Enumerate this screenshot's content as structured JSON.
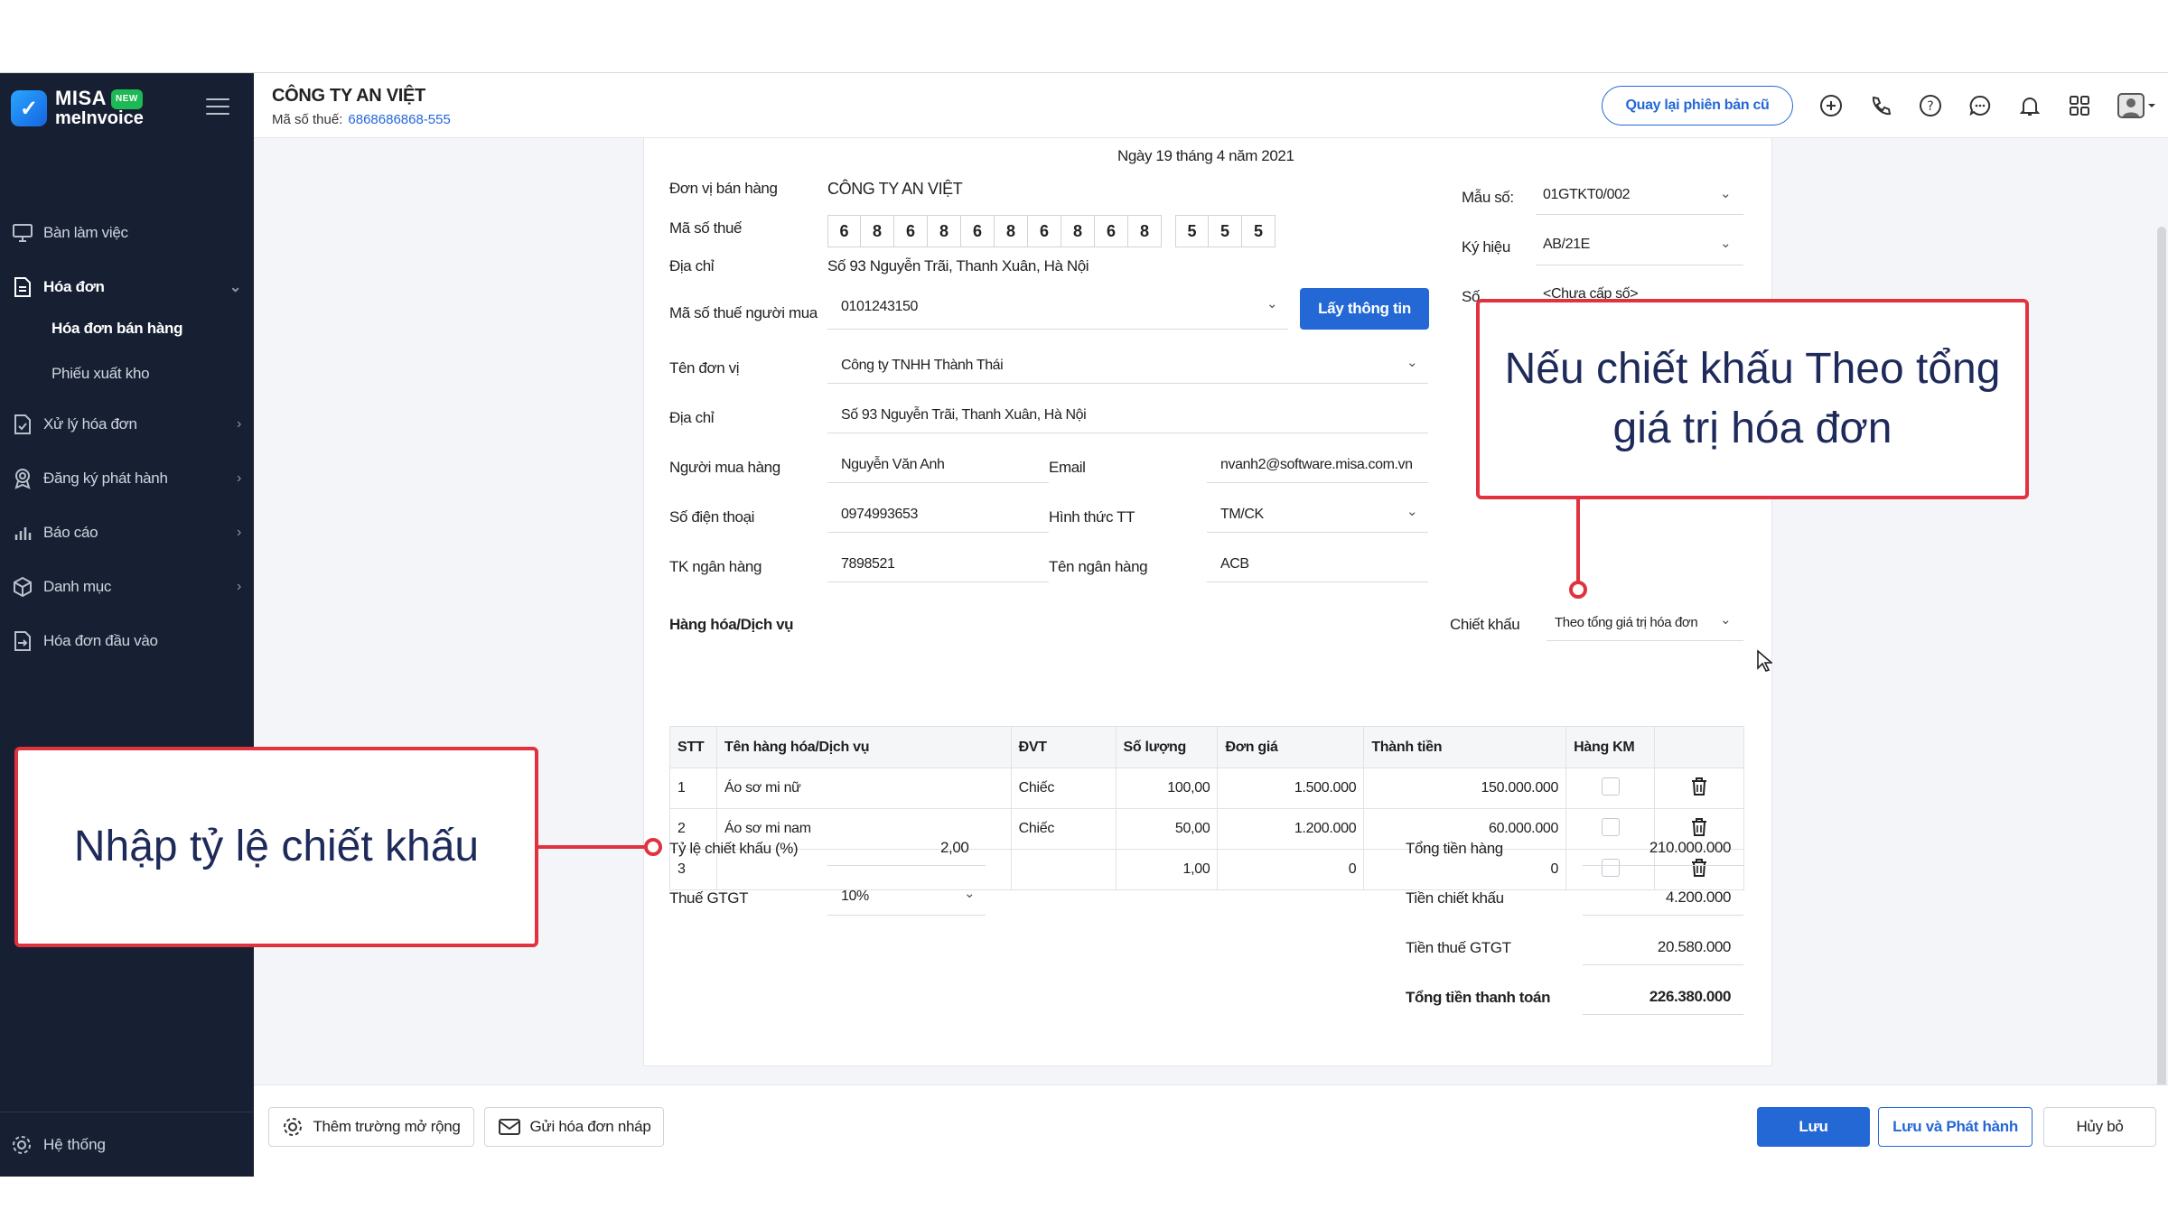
{
  "sidebar": {
    "logo_line1": "MISA",
    "logo_line2": "meInvoice",
    "logo_badge": "NEW",
    "items": [
      {
        "label": "Bàn làm việc"
      },
      {
        "label": "Hóa đơn"
      },
      {
        "label": "Xử lý hóa đơn"
      },
      {
        "label": "Đăng ký phát hành"
      },
      {
        "label": "Báo cáo"
      },
      {
        "label": "Danh mục"
      },
      {
        "label": "Hóa đơn đầu vào"
      }
    ],
    "subitems": [
      {
        "label": "Hóa đơn bán hàng"
      },
      {
        "label": "Phiếu xuất kho"
      }
    ],
    "system": "Hệ thống"
  },
  "header": {
    "company": "CÔNG TY AN VIỆT",
    "tax_label": "Mã số thuế:",
    "tax_value": "6868686868-555",
    "back_button": "Quay lại phiên bản cũ"
  },
  "form": {
    "date": "Ngày 19 tháng 4 năm 2021",
    "seller_label": "Đơn vị bán hàng",
    "seller_value": "CÔNG TY AN VIỆT",
    "seller_tax_label": "Mã số thuế",
    "seller_tax_digits": [
      "6",
      "8",
      "6",
      "8",
      "6",
      "8",
      "6",
      "8",
      "6",
      "8"
    ],
    "seller_tax_suffix": [
      "5",
      "5",
      "5"
    ],
    "seller_address_label": "Địa chỉ",
    "seller_address": "Số 93 Nguyễn Trãi, Thanh Xuân, Hà Nội",
    "template_label": "Mẫu số:",
    "template_value": "01GTKT0/002",
    "symbol_label": "Ký hiệu",
    "symbol_value": "AB/21E",
    "number_label": "Số",
    "number_value": "<Chưa cấp số>",
    "buyer_tax_label": "Mã số thuế người mua",
    "buyer_tax_value": "0101243150",
    "get_info_button": "Lấy thông tin",
    "unit_label": "Tên đơn vị",
    "unit_value": "Công ty TNHH Thành Thái",
    "address_label": "Địa chỉ",
    "address_value": "Số 93 Nguyễn Trãi, Thanh Xuân, Hà Nội",
    "buyer_label": "Người mua hàng",
    "buyer_value": "Nguyễn Văn Anh",
    "email_label": "Email",
    "email_value": "nvanh2@software.misa.com.vn",
    "phone_label": "Số điện thoại",
    "phone_value": "0974993653",
    "payment_label": "Hình thức TT",
    "payment_value": "TM/CK",
    "bank_acc_label": "TK ngân hàng",
    "bank_acc_value": "7898521",
    "bank_name_label": "Tên ngân hàng",
    "bank_name_value": "ACB"
  },
  "items_section": {
    "title": "Hàng hóa/Dịch vụ",
    "discount_label": "Chiết khấu",
    "discount_value": "Theo tổng giá trị hóa đơn",
    "columns": [
      "STT",
      "Tên hàng hóa/Dịch vụ",
      "ĐVT",
      "Số lượng",
      "Đơn giá",
      "Thành tiền",
      "Hàng KM"
    ],
    "rows": [
      {
        "stt": "1",
        "name": "Áo sơ mi nữ",
        "unit": "Chiếc",
        "qty": "100,00",
        "price": "1.500.000",
        "amount": "150.000.000"
      },
      {
        "stt": "2",
        "name": "Áo sơ mi nam",
        "unit": "Chiếc",
        "qty": "50,00",
        "price": "1.200.000",
        "amount": "60.000.000"
      },
      {
        "stt": "3",
        "name": "",
        "unit": "",
        "qty": "1,00",
        "price": "0",
        "amount": "0"
      }
    ]
  },
  "totals": {
    "discount_rate_label": "Tỷ lệ chiết khấu (%)",
    "discount_rate_value": "2,00",
    "vat_label": "Thuế GTGT",
    "vat_value": "10%",
    "goods_total_label": "Tổng tiền hàng",
    "goods_total_value": "210.000.000",
    "discount_amount_label": "Tiền chiết khấu",
    "discount_amount_value": "4.200.000",
    "vat_amount_label": "Tiền thuế GTGT",
    "vat_amount_value": "20.580.000",
    "grand_total_label": "Tổng tiền thanh toán",
    "grand_total_value": "226.380.000"
  },
  "footer": {
    "extend_button": "Thêm trường mở rộng",
    "send_draft_button": "Gửi hóa đơn nháp",
    "save_button": "Lưu",
    "save_publish_button": "Lưu và Phát hành",
    "cancel_button": "Hủy bỏ"
  },
  "callouts": {
    "top_right": "Nếu chiết khấu Theo tổng giá trị hóa đơn",
    "left": "Nhập tỷ lệ chiết khấu"
  },
  "colors": {
    "sidebar_bg": "#172033",
    "accent": "#2468d6",
    "callout_border": "#e0333f",
    "callout_text": "#1e2a5a"
  }
}
